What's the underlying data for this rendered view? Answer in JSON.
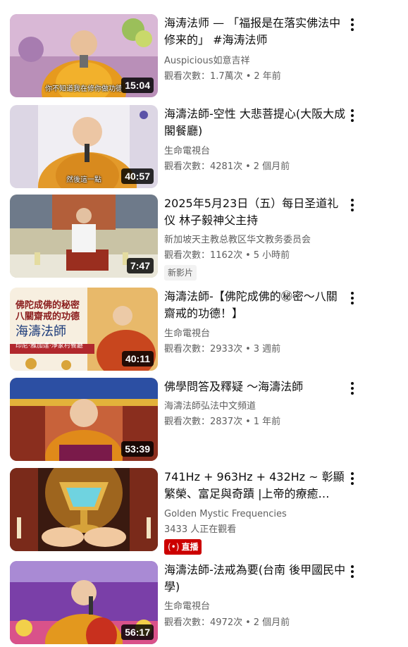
{
  "videos": [
    {
      "title": "海涛法师 — 「福报是在落实佛法中修来的」 #海涛法师",
      "channel": "Auspicious如意吉祥",
      "views": "觀看次數：1.7萬次",
      "age": "2 年前",
      "duration": "15:04",
      "thumb_caption": "你不知道我在修你做功德"
    },
    {
      "title": "海濤法師-空性 大悲菩提心(大阪大成閣餐廳)",
      "channel": "生命電視台",
      "views": "觀看次數：4281次",
      "age": "2 個月前",
      "duration": "40:57",
      "thumb_caption": "然後這一點"
    },
    {
      "title": "2025年5月23日（五）每日圣道礼仪 林子毅神父主持",
      "channel": "新加坡天主教总教区华文教务委员会",
      "views": "觀看次數：1162次",
      "age": "5 小時前",
      "duration": "7:47",
      "badge": "新影片"
    },
    {
      "title": "海濤法師-【佛陀成佛的㊙密～八關齋戒的功德！】",
      "channel": "生命電視台",
      "views": "觀看次數：2933次",
      "age": "3 週前",
      "duration": "40:11",
      "thumb_text": {
        "line1": "佛陀成佛的秘密",
        "line2": "八關齋戒的功德",
        "line3": "海濤法師",
        "line4": "印尼‧雅加達‧淨家村餐廳"
      }
    },
    {
      "title": "佛學問答及釋疑 〜海濤法師",
      "channel": "海濤法師弘法中文頻道",
      "views": "觀看次數：2837次",
      "age": "1 年前",
      "duration": "53:39"
    },
    {
      "title": "741Hz + 963Hz + 432Hz ~ 彰顯繁榮、富足與奇蹟 |上帝的療癒…",
      "channel": "Golden Mystic Frequencies",
      "views": "3433 人正在觀看",
      "age": "",
      "live_badge": "直播",
      "live_icon": "(•)"
    },
    {
      "title": "海濤法師-法戒為要(台南 後甲國民中學)",
      "channel": "生命電視台",
      "views": "觀看次數：4972次",
      "age": "2 個月前",
      "duration": "56:17"
    }
  ],
  "dot": "•",
  "colors": {
    "text_primary": "#0f0f0f",
    "text_secondary": "#606060",
    "live_red": "#cc0000",
    "duration_bg": "#000000"
  }
}
